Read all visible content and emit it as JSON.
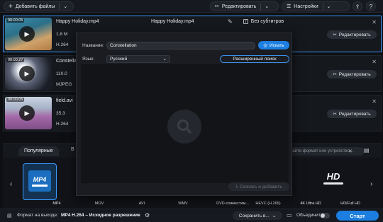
{
  "toolbar": {
    "add_files": "Добавить файлы",
    "edit": "Редактировать",
    "settings": "Настройки"
  },
  "files": [
    {
      "name": "Happy Holiday.mp4",
      "duration": "00:00:05",
      "meta1": "1.8 M",
      "meta2": "H.264",
      "out_name": "Happy Holiday.mp4",
      "subtitles": "Без субтитров",
      "edit": "Редактировать"
    },
    {
      "name": "Constella",
      "duration": "00:00:27",
      "meta1": "110.0",
      "meta2": "MJPEG",
      "edit": "Редактировать"
    },
    {
      "name": "field.avi",
      "duration": "00:00:05",
      "meta1": "35.3",
      "meta2": "H.264",
      "edit": "Редактировать"
    }
  ],
  "dialog": {
    "name_label": "Название:",
    "name_value": "Constellation",
    "search_button": "Искать",
    "lang_label": "Язык:",
    "lang_value": "Русский",
    "advanced_button": "Расширенный поиск",
    "download_button": "Скачать и добавить"
  },
  "format_panel": {
    "tab_popular": "Популярные",
    "tab_video": "В",
    "search_placeholder": "Найти формат или устройство...",
    "formats": [
      {
        "label": "MP4",
        "icon_text": "MP4",
        "selected": true
      },
      {
        "label": "MOV"
      },
      {
        "label": "AVI"
      },
      {
        "label": "WMV"
      },
      {
        "label": "DVD-совместим..."
      },
      {
        "label": "HEVC (H.265)"
      },
      {
        "label": "4K Ultra HD"
      },
      {
        "label": "HD/Full HD",
        "icon_text": "HD"
      }
    ]
  },
  "status": {
    "output_label": "Формат на выходе:",
    "output_value": "MP4 H.264 – Исходное разрешение",
    "save_button": "Сохранить в...",
    "merge_label": "Объединить:",
    "start_button": "Старт"
  },
  "colors": {
    "accent": "#1c7ee0",
    "select_border": "#3b9bff"
  }
}
